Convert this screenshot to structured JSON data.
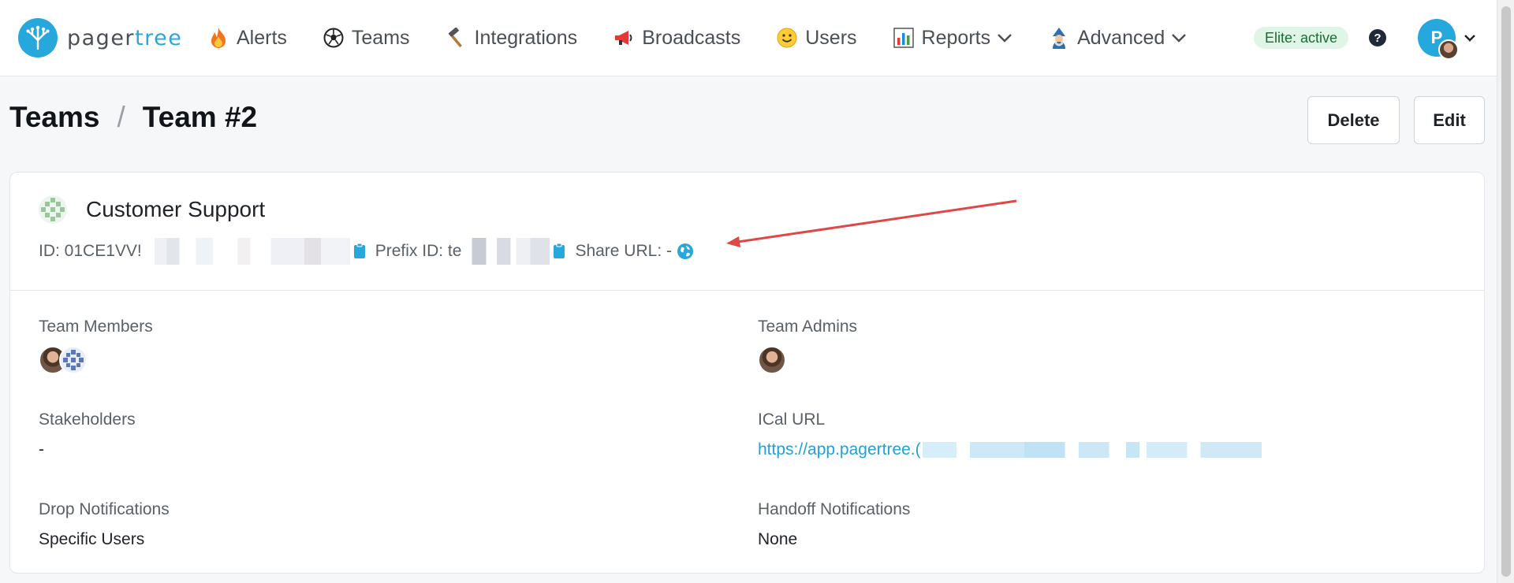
{
  "nav": {
    "logo_text_primary": "pager",
    "logo_text_accent": "tree",
    "items": [
      {
        "label": "Alerts",
        "icon": "fire-icon"
      },
      {
        "label": "Teams",
        "icon": "soccer-ball-icon"
      },
      {
        "label": "Integrations",
        "icon": "hammer-icon"
      },
      {
        "label": "Broadcasts",
        "icon": "megaphone-icon"
      },
      {
        "label": "Users",
        "icon": "smiley-icon"
      },
      {
        "label": "Reports",
        "icon": "bar-chart-icon"
      },
      {
        "label": "Advanced",
        "icon": "mage-icon"
      }
    ],
    "plan_badge": "Elite: active",
    "help": "?",
    "user_initial": "P"
  },
  "header": {
    "breadcrumb_root": "Teams",
    "breadcrumb_separator": "/",
    "breadcrumb_current": "Team #2",
    "delete_label": "Delete",
    "edit_label": "Edit"
  },
  "team": {
    "name": "Customer Support",
    "id_label": "ID: 01CE1VV!",
    "prefix_label": "Prefix ID: te",
    "share_label": "Share URL: -"
  },
  "fields": {
    "members_label": "Team Members",
    "admins_label": "Team Admins",
    "stakeholders_label": "Stakeholders",
    "stakeholders_value": "-",
    "ical_label": "ICal URL",
    "ical_value": "https://app.pagertree.(",
    "drop_label": "Drop Notifications",
    "drop_value": "Specific Users",
    "handoff_label": "Handoff Notifications",
    "handoff_value": "None"
  },
  "colors": {
    "brand": "#27a8dc",
    "link": "#1fa3d6",
    "badge_bg": "#dff6e6",
    "annotation_arrow": "#e04848"
  }
}
